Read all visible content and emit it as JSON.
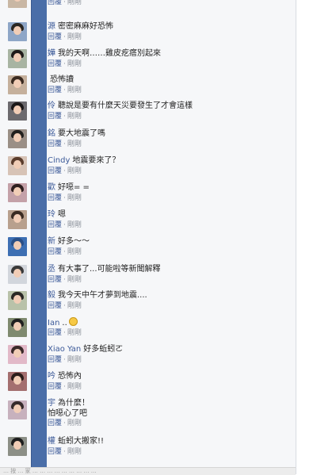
{
  "ui": {
    "reply_label": "回覆",
    "time_label": "剛剛",
    "separator": "·"
  },
  "colors": {
    "side_bar": "#4a6ea8",
    "link": "#3b5998",
    "panel": "#f6f7f9"
  },
  "comments": [
    {
      "name": "",
      "message": "",
      "avatar": {
        "bg": "#c9b7a4",
        "hair": "#3a2e27"
      }
    },
    {
      "name": "源",
      "message": "密密麻麻好恐怖",
      "avatar": {
        "bg": "#8ea6c7",
        "hair": "#2a2622"
      }
    },
    {
      "name": "嬅",
      "message": "我的天啊……雞皮疙瘩別起來",
      "avatar": {
        "bg": "#a8b4a2",
        "hair": "#1f1b19"
      }
    },
    {
      "name": "",
      "message": "恐怖讀",
      "avatar": {
        "bg": "#c5b09c",
        "hair": "#3a2a20"
      }
    },
    {
      "name": "伶",
      "message": "聽說是要有什麼天災要發生了才會這樣",
      "avatar": {
        "bg": "#6c6a6e",
        "hair": "#1b1818"
      }
    },
    {
      "name": "銘",
      "message": "要大地震了嗎",
      "avatar": {
        "bg": "#9a8f86",
        "hair": "#22201e"
      }
    },
    {
      "name": "Cindy",
      "message": "地震要來了？",
      "avatar": {
        "bg": "#d7c3b6",
        "hair": "#5a3c2c"
      }
    },
    {
      "name": "歡",
      "message": "好噁= =",
      "avatar": {
        "bg": "#c4a1a8",
        "hair": "#2d1f1f"
      }
    },
    {
      "name": "玲",
      "message": "嗯",
      "avatar": {
        "bg": "#b8a08d",
        "hair": "#3a2b22"
      }
    },
    {
      "name": "新",
      "message": "好多～～",
      "avatar": {
        "bg": "#3d6fb3",
        "hair": "#2a4f86"
      }
    },
    {
      "name": "丞",
      "message": "有大事了...可能啦等新聞解釋",
      "avatar": {
        "bg": "#d2d6dc",
        "hair": "#3a3a3a"
      }
    },
    {
      "name": "毅",
      "message": "我今天中午才夢到地震....",
      "avatar": {
        "bg": "#b9c2a9",
        "hair": "#2a2824"
      }
    },
    {
      "name": "Ian",
      "message": "..",
      "emoji": "scared-face-emoji",
      "avatar": {
        "bg": "#7f8a6f",
        "hair": "#202020"
      }
    },
    {
      "name": "Xiao Yan",
      "message": "好多蚯蚓ㄛ",
      "avatar": {
        "bg": "#e2b9c8",
        "hair": "#3b2a2a"
      }
    },
    {
      "name": "吟",
      "message": "恐怖內",
      "avatar": {
        "bg": "#a46f6f",
        "hair": "#2b1d1a"
      }
    },
    {
      "name": "宇",
      "message": "為什麼！",
      "message2": "怕噁心了吧",
      "avatar": {
        "bg": "#c7b1bd",
        "hair": "#352a2a"
      }
    },
    {
      "name": "權",
      "message": "蚯蚓大搬家!!",
      "avatar": {
        "bg": "#8c8f86",
        "hair": "#1e1e1e"
      }
    }
  ],
  "status_bar": {
    "text": "… 按 … 家 … … … … … … … … …"
  }
}
